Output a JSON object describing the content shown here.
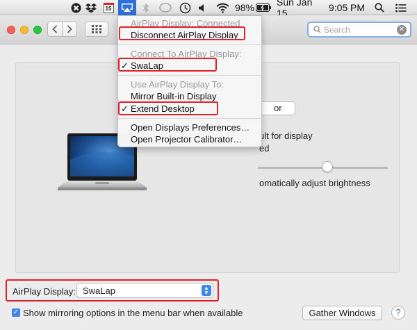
{
  "menubar": {
    "battery_percent": "98%",
    "calendar_day": "15",
    "date": "Sun Jan 15",
    "time": "9:05 PM"
  },
  "toolbar": {
    "search_placeholder": "Search",
    "grid_icon": "grid-icon"
  },
  "airplay_menu": {
    "header_connected": "AirPlay Display: Connected",
    "disconnect": "Disconnect AirPlay Display",
    "header_connect_to": "Connect To AirPlay Display:",
    "device": "SwaLap",
    "header_use_to": "Use AirPlay Display To:",
    "mirror": "Mirror Built-in Display",
    "extend": "Extend Desktop",
    "open_prefs": "Open Displays Preferences…",
    "open_calibrator": "Open Projector Calibrator…",
    "check_mark": "✓"
  },
  "panel": {
    "detect_partial": "or",
    "resolution_partial": "ult for display",
    "scaled_partial": "ed",
    "brightness_partial": "omatically adjust brightness",
    "brightness_level": 0.55
  },
  "bottom": {
    "airplay_label": "AirPlay Display:",
    "airplay_value": "SwaLap",
    "show_mirroring": "Show mirroring options in the menu bar when available",
    "show_mirroring_checked": true,
    "gather_windows": "Gather Windows",
    "help": "?"
  },
  "colors": {
    "highlight": "#e0212b",
    "accent": "#3e86ea",
    "airplay_active": "#2f6fdb"
  }
}
